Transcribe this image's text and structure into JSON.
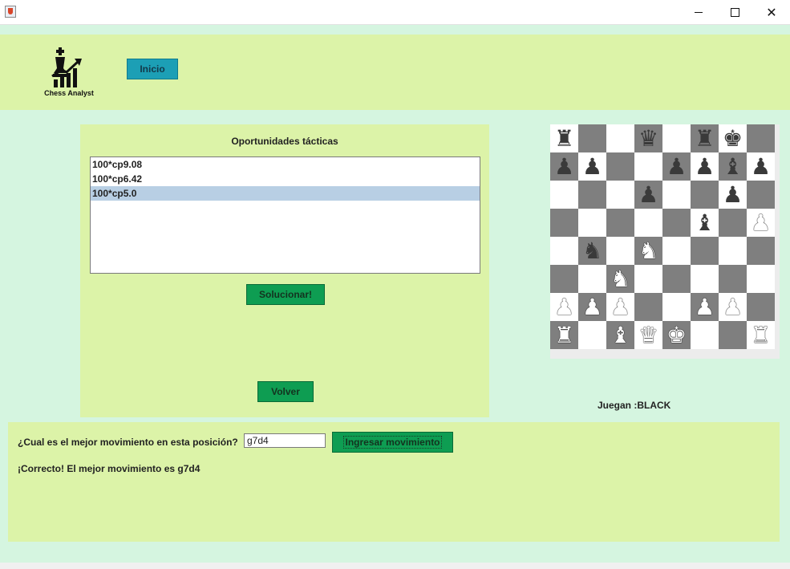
{
  "window": {
    "app_icon": "java-cup-icon",
    "controls": {
      "minimize": "—",
      "maximize": "☐",
      "close": "✕"
    }
  },
  "header": {
    "logo_text": "Chess Analyst",
    "logo_icon": "chess-king-growth-chart-icon",
    "home_button": "Inicio"
  },
  "tactics_panel": {
    "title": "Oportunidades tácticas",
    "items": [
      "100*cp9.08",
      "100*cp6.42",
      "100*cp5.0"
    ],
    "selected_index": 2,
    "solve_button": "Solucionar!",
    "back_button": "Volver"
  },
  "board": {
    "ranks": [
      [
        "r",
        "",
        "",
        "q",
        "",
        "r",
        "k",
        ""
      ],
      [
        "p",
        "p",
        "",
        "",
        "p",
        "p",
        "b",
        "p"
      ],
      [
        "",
        "",
        "",
        "p",
        "",
        "",
        "p",
        ""
      ],
      [
        "",
        "",
        "",
        "",
        "",
        "b",
        "",
        "P"
      ],
      [
        "",
        "n",
        "",
        "N",
        "",
        "",
        "",
        ""
      ],
      [
        "",
        "",
        "N",
        "",
        "",
        "",
        "",
        ""
      ],
      [
        "P",
        "P",
        "P",
        "",
        "",
        "P",
        "P",
        ""
      ],
      [
        "R",
        "",
        "B",
        "Q",
        "K",
        "",
        "",
        "R"
      ]
    ],
    "turn_label": "Juegan :BLACK",
    "colors": {
      "light_square": "#ffffff",
      "dark_square": "#7f7f7f"
    }
  },
  "bottom_panel": {
    "question": "¿Cual es el mejor movimiento en esta posición?",
    "move_value": "g7d4",
    "submit_button": "Ingresar movimiento",
    "result": "¡Correcto! El mejor movimiento es g7d4"
  },
  "colors": {
    "panel": "#dcf3a8",
    "background": "#d5f5e0",
    "button_green": "#0e9d52",
    "button_teal": "#1c9fb5",
    "selection": "#b8cfe4"
  }
}
